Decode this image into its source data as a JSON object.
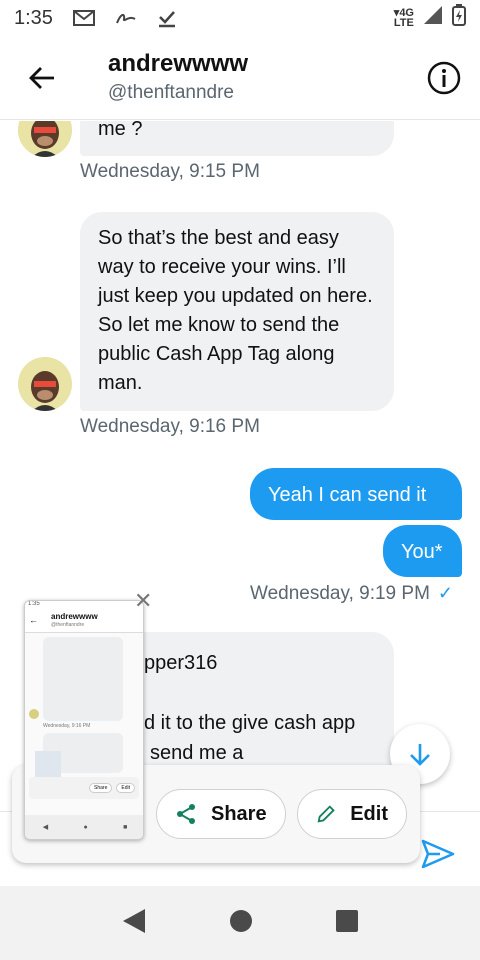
{
  "status_bar": {
    "time": "1:35",
    "network": "4G\nLTE"
  },
  "header": {
    "name": "andrewwww",
    "handle": "@thenftanndre"
  },
  "messages": {
    "m1": {
      "text": "me ?",
      "time": "Wednesday, 9:15 PM"
    },
    "m2": {
      "text": "So that’s the best and easy way to receive your wins. I’ll just keep you updated on here. So let me know to send the public Cash App Tag along man.",
      "time": "Wednesday, 9:16 PM"
    },
    "m3": {
      "text": "Yeah I can send it"
    },
    "m4": {
      "text": "You*",
      "time": "Wednesday, 9:19 PM"
    },
    "m5": {
      "line1": "pper316",
      "line2": "d it to the give cash app",
      "line3": "send me a"
    }
  },
  "share_sheet": {
    "share_label": "Share",
    "edit_label": "Edit"
  },
  "thumbnail": {
    "name": "andrewwww",
    "handle": "@thenftanndre",
    "preview_time": "Wednesday, 9:16 PM",
    "share_label": "Share",
    "edit_label": "Edit"
  }
}
